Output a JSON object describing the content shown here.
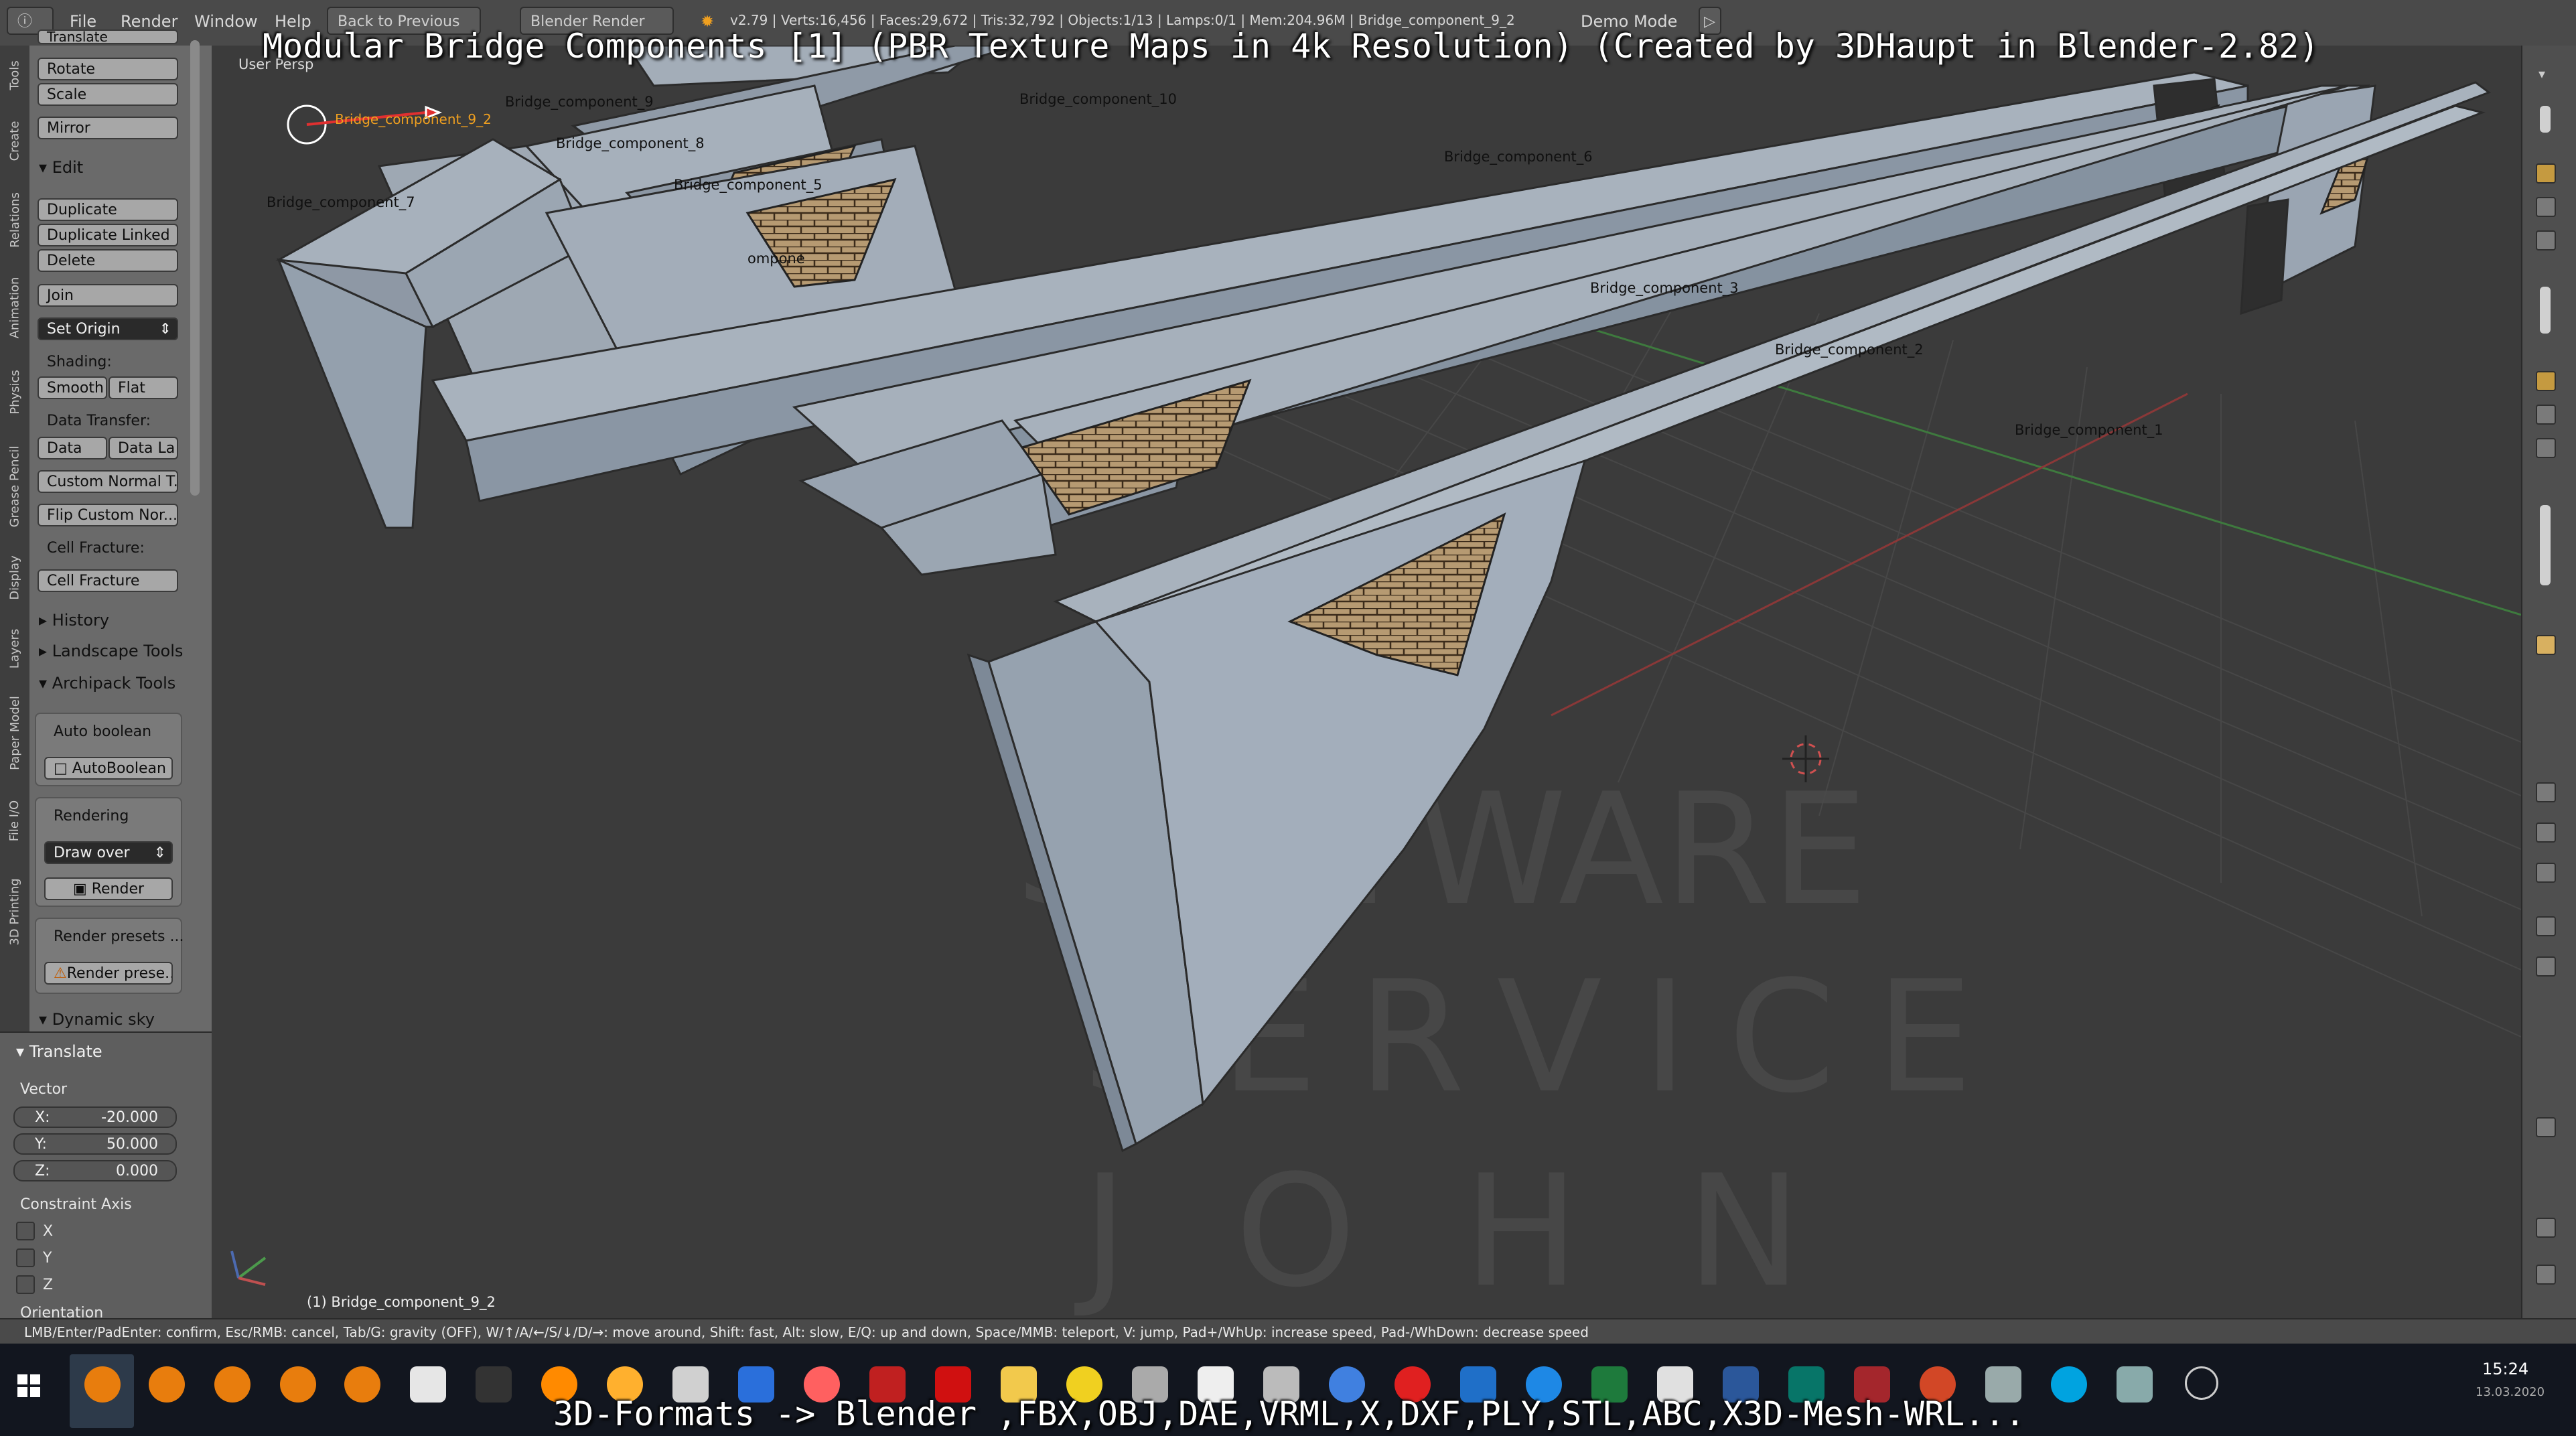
{
  "video_title": "Modular Bridge Components [1] (PBR Texture Maps in 4k Resolution) (Created by 3DHaupt in Blender-2.82)",
  "subtitle": "3D-Formats -> Blender ,FBX,OBJ,DAE,VRML,X,DXF,PLY,STL,ABC,X3D-Mesh-WRL...",
  "menu": {
    "file": "File",
    "render": "Render",
    "window": "Window",
    "help": "Help",
    "back": "Back to Previous",
    "engine": "Blender Render",
    "stats": "v2.79 | Verts:16,456 | Faces:29,672 | Tris:32,792 | Objects:1/13 | Lamps:0/1 | Mem:204.96M | Bridge_component_9_2",
    "demo": "Demo Mode"
  },
  "vertical_tabs": [
    "Tools",
    "Create",
    "Relations",
    "Animation",
    "Physics",
    "Grease Pencil",
    "Display",
    "Layers",
    "Paper Model",
    "File I/O",
    "3D Printing"
  ],
  "tool_shelf": {
    "translate": "Translate",
    "rotate": "Rotate",
    "scale": "Scale",
    "mirror": "Mirror",
    "edit_header": "Edit",
    "duplicate": "Duplicate",
    "duplicate_linked": "Duplicate Linked",
    "delete": "Delete",
    "join": "Join",
    "set_origin": "Set Origin",
    "shading_label": "Shading:",
    "smooth": "Smooth",
    "flat": "Flat",
    "data_transfer_label": "Data Transfer:",
    "data": "Data",
    "data_la": "Data La",
    "custom_normal": "Custom Normal T...",
    "flip_custom": "Flip Custom Nor...",
    "cell_fracture_label": "Cell Fracture:",
    "cell_fracture": "Cell Fracture",
    "history": "History",
    "landscape": "Landscape Tools",
    "archipack": "Archipack Tools",
    "auto_boolean_label": "Auto boolean",
    "autoboolean": "AutoBoolean",
    "rendering_label": "Rendering",
    "draw_over": "Draw over",
    "render": "Render",
    "render_presets_label": "Render presets ...",
    "render_presets_btn": "Render prese...",
    "dynamic_sky": "Dynamic sky"
  },
  "operator_panel": {
    "header": "Translate",
    "vector_label": "Vector",
    "x_key": "X:",
    "x_val": "-20.000",
    "y_key": "Y:",
    "y_val": "50.000",
    "z_key": "Z:",
    "z_val": "0.000",
    "constraint_label": "Constraint Axis",
    "cx": "X",
    "cy": "Y",
    "cz": "Z",
    "orientation": "Orientation"
  },
  "viewport": {
    "view_name": "User Persp",
    "active_object": "(1) Bridge_component_9_2",
    "watermark": [
      "SOFTWARE",
      "SERVICE",
      "JOHN"
    ],
    "selected_label": "Bridge_component_9_2",
    "objects": {
      "c1": "Bridge_component_1",
      "c2": "Bridge_component_2",
      "c3": "Bridge_component_3",
      "c5": "Bridge_component_5",
      "c6": "Bridge_component_6",
      "c7": "Bridge_component_7",
      "c8": "Bridge_component_8",
      "c9": "Bridge_component_9",
      "c10": "Bridge_component_10",
      "partial": "ompone"
    }
  },
  "hint": "LMB/Enter/PadEnter: confirm, Esc/RMB: cancel, Tab/G: gravity (OFF), W/↑/A/←/S/↓/D/→: move around, Shift: fast, Alt: slow, E/Q: up and down, Space/MMB: teleport, V: jump, Pad+/WhUp: increase speed, Pad-/WhDown: decrease speed",
  "clock": {
    "time": "15:24",
    "date": "13.03.2020"
  },
  "colors": {
    "concrete": "#8e9bab",
    "brick": "#b69a72",
    "accent": "#f0a020"
  }
}
